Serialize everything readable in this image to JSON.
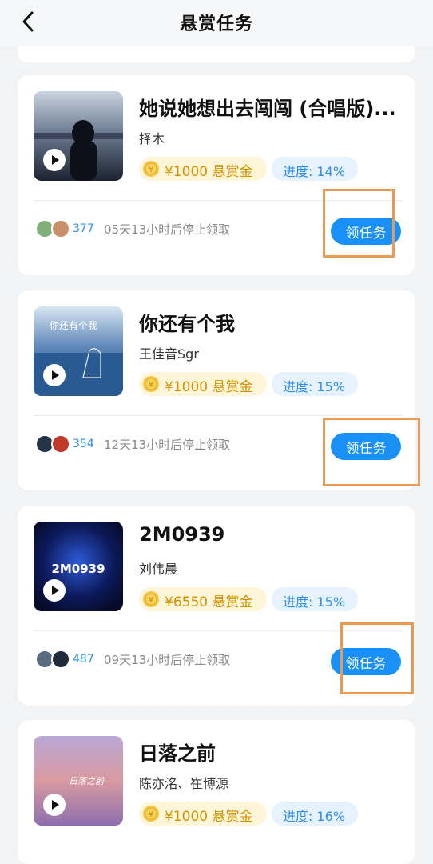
{
  "header": {
    "title": "悬赏任务",
    "back_icon": "chevron-left-icon"
  },
  "tasks": [
    {
      "song": "她说她想出去闯闯 (合唱版)...",
      "artist": "择木",
      "reward": "¥1000 悬赏金",
      "progress": "进度: 14%",
      "participants": "377",
      "deadline": "05天13小时后停止领取",
      "claim_label": "领任务"
    },
    {
      "song": "你还有个我",
      "artist": "王佳音Sgr",
      "reward": "¥1000 悬赏金",
      "progress": "进度: 15%",
      "participants": "354",
      "deadline": "12天13小时后停止领取",
      "claim_label": "领任务"
    },
    {
      "song": "2M0939",
      "artist": "刘伟晨",
      "reward": "¥6550 悬赏金",
      "progress": "进度: 15%",
      "participants": "487",
      "deadline": "09天13小时后停止领取",
      "claim_label": "领任务"
    },
    {
      "song": "日落之前",
      "artist": "陈亦洺、崔博源",
      "reward": "¥1000 悬赏金",
      "progress": "进度: 16%"
    }
  ],
  "cover_art_text": {
    "cover2": "你还有个我",
    "cover3": "2M0939",
    "cover4": "日落之前"
  },
  "colors": {
    "accent": "#1890f5",
    "reward_text": "#d39200",
    "reward_bg": "#fff6da",
    "progress_text": "#2f8fe8",
    "progress_bg": "#e6f3ff",
    "annotation_box": "#ea9a53"
  }
}
